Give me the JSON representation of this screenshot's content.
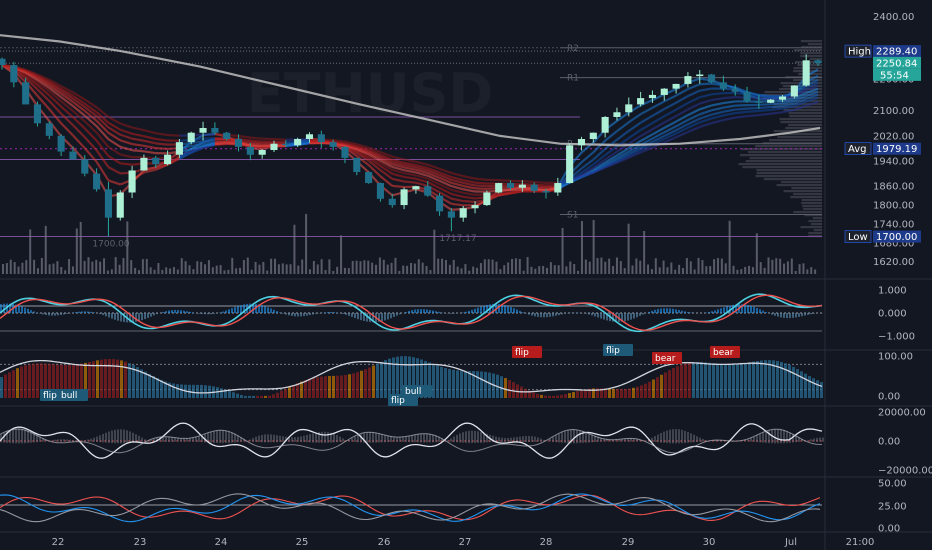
{
  "chart_data": {
    "type": "candlestick",
    "symbol_watermark": "ETHUSD",
    "x_labels": [
      "22",
      "23",
      "24",
      "25",
      "26",
      "27",
      "28",
      "29",
      "30",
      "Jul",
      "21:00"
    ],
    "price_axis": {
      "ticks": [
        "2400.00",
        "2200.00",
        "2100.00",
        "2020.00",
        "1940.00",
        "1860.00",
        "1800.00",
        "1740.00",
        "1680.00",
        "1620.00"
      ],
      "range": [
        1600,
        2420
      ]
    },
    "price_tags": {
      "high": {
        "label": "High",
        "value": "2289.40"
      },
      "last": {
        "value": "2250.84",
        "countdown": "55:54"
      },
      "avg": {
        "label": "Avg",
        "value": "1979.19"
      },
      "low": {
        "label": "Low",
        "value": "1700.00"
      }
    },
    "pivot_labels": [
      "R2",
      "R1",
      "P",
      "S1"
    ],
    "pivot_values": [
      2300,
      2205,
      1995,
      1770
    ],
    "low_annotations": [
      "1700.00",
      "1717.17"
    ],
    "close_series": [
      2245,
      2190,
      2120,
      2060,
      2020,
      1970,
      1945,
      1900,
      1850,
      1760,
      1840,
      1910,
      1950,
      1930,
      1960,
      2000,
      2030,
      2045,
      2030,
      2010,
      1985,
      1960,
      1975,
      1995,
      1990,
      2010,
      2025,
      2000,
      1985,
      1950,
      1905,
      1870,
      1820,
      1800,
      1850,
      1860,
      1830,
      1780,
      1760,
      1790,
      1800,
      1840,
      1870,
      1855,
      1865,
      1845,
      1840,
      1870,
      1990,
      2010,
      2030,
      2080,
      2095,
      2120,
      2140,
      2150,
      2170,
      2185,
      2210,
      2215,
      2190,
      2170,
      2160,
      2130,
      2125,
      2135,
      2145,
      2180,
      2260,
      2251
    ],
    "oscillators": [
      {
        "name": "panel1",
        "ticks": [
          "1.000",
          "0.000",
          "−1.000"
        ]
      },
      {
        "name": "panel2",
        "ticks": [
          "100.00",
          "0.00"
        ],
        "signals": [
          {
            "label": "flip",
            "kind": "bull"
          },
          {
            "label": "bull",
            "kind": "bull"
          },
          {
            "label": "flip",
            "kind": "bull"
          },
          {
            "label": "bull",
            "kind": "bull"
          },
          {
            "label": "flip",
            "kind": "bear"
          },
          {
            "label": "flip",
            "kind": "bull"
          },
          {
            "label": "bear",
            "kind": "bear"
          },
          {
            "label": "bear",
            "kind": "bear"
          }
        ]
      },
      {
        "name": "panel3",
        "ticks": [
          "20000.00",
          "0.00",
          "−20000.00"
        ]
      },
      {
        "name": "panel4",
        "ticks": [
          "50.00",
          "25.00",
          "0.00"
        ]
      }
    ],
    "colors": {
      "bull": "#26a69a",
      "bull_bright": "#8fe5c5",
      "bear": "#ef5350",
      "bg": "#131722",
      "grid": "#2a2e39",
      "tag_blue": "#1e3a8a",
      "tag_green": "#26a69a"
    }
  }
}
